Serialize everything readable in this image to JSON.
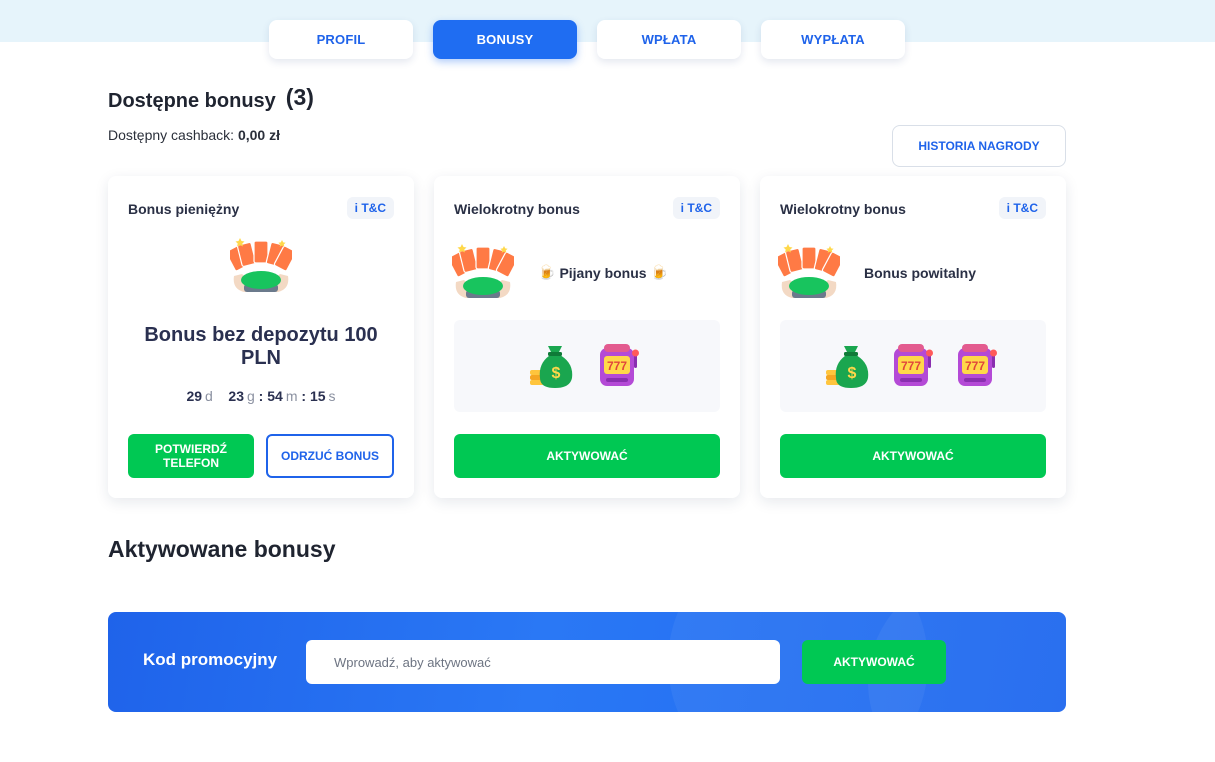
{
  "tabs": [
    {
      "label": "PROFIL",
      "active": false
    },
    {
      "label": "BONUSY",
      "active": true
    },
    {
      "label": "WPŁATA",
      "active": false
    },
    {
      "label": "WYPŁATA",
      "active": false
    }
  ],
  "available": {
    "title": "Dostępne bonusy",
    "count": "(3)",
    "cashback_label": "Dostępny cashback:",
    "cashback_value": "0,00 zł",
    "history_button": "HISTORIA NAGRODY"
  },
  "cards": [
    {
      "title": "Bonus pieniężny",
      "tc": "i T&C",
      "bonus_name": "Bonus bez depozytu 100 PLN",
      "timer": {
        "days": "29",
        "days_unit": "d",
        "hours": "23",
        "hours_unit": "g",
        "minutes": "54",
        "minutes_unit": "m",
        "seconds": "15",
        "seconds_unit": "s"
      },
      "confirm_button": "POTWIERDŹ TELEFON",
      "reject_button": "ODRZUĆ BONUS"
    },
    {
      "title": "Wielokrotny bonus",
      "tc": "i T&C",
      "bonus_name": "Pijany bonus",
      "activate_button": "AKTYWOWAĆ"
    },
    {
      "title": "Wielokrotny bonus",
      "tc": "i T&C",
      "bonus_name": "Bonus powitalny",
      "activate_button": "AKTYWOWAĆ"
    }
  ],
  "activated": {
    "title": "Aktywowane bonusy"
  },
  "promo": {
    "label": "Kod promocyjny",
    "placeholder": "Wprowadź, aby aktywować",
    "button": "AKTYWOWAĆ"
  },
  "icons": {
    "cards_fan": "playing-cards-icon",
    "money_bag": "money-bag-icon",
    "slot_machine": "slot-machine-icon",
    "beer": "beer-icon"
  },
  "colors": {
    "brand_blue": "#1f63ea",
    "success_green": "#00c853",
    "band": "#e6f4fb"
  }
}
